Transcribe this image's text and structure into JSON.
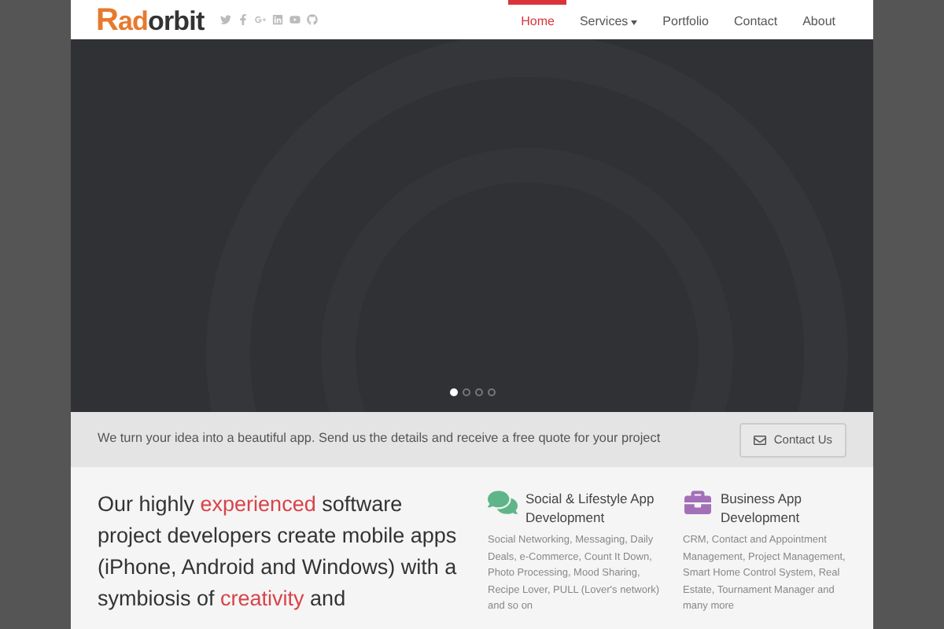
{
  "logo": {
    "first": "R",
    "rest_accent": "ad",
    "rest": "orbit"
  },
  "nav": [
    {
      "label": "Home",
      "selected": true,
      "dropdown": false
    },
    {
      "label": "Services",
      "selected": false,
      "dropdown": true
    },
    {
      "label": "Portfolio",
      "selected": false,
      "dropdown": false
    },
    {
      "label": "Contact",
      "selected": false,
      "dropdown": false
    },
    {
      "label": "About",
      "selected": false,
      "dropdown": false
    }
  ],
  "slider": {
    "dots": [
      {
        "selected": true
      },
      {
        "selected": false
      },
      {
        "selected": false
      },
      {
        "selected": false
      }
    ]
  },
  "quote_bar": {
    "text": "We turn your idea into a beautiful app. Send us the details and receive a free quote for your project",
    "button": "Contact Us"
  },
  "intro": [
    {
      "text": "Our highly ",
      "highlight": false
    },
    {
      "text": "experienced",
      "highlight": true
    },
    {
      "text": " software project developers create mobile apps (iPhone, Android and Windows) with a symbiosis of ",
      "highlight": false
    },
    {
      "text": "creativity",
      "highlight": true
    },
    {
      "text": " and",
      "highlight": false
    }
  ],
  "services": [
    {
      "kind": "chat",
      "title": "Social & Lifestyle App Development",
      "text": "Social Networking, Messaging, Daily Deals, e-Commerce, Count It Down, Photo Processing, Mood Sharing, Recipe Lover, PULL (Lover's network) and so on"
    },
    {
      "kind": "briefcase",
      "title": "Business App Development",
      "text": "CRM, Contact and Appointment Management, Project Management, Smart Home Control System, Real Estate, Tournament Manager and many more"
    }
  ]
}
